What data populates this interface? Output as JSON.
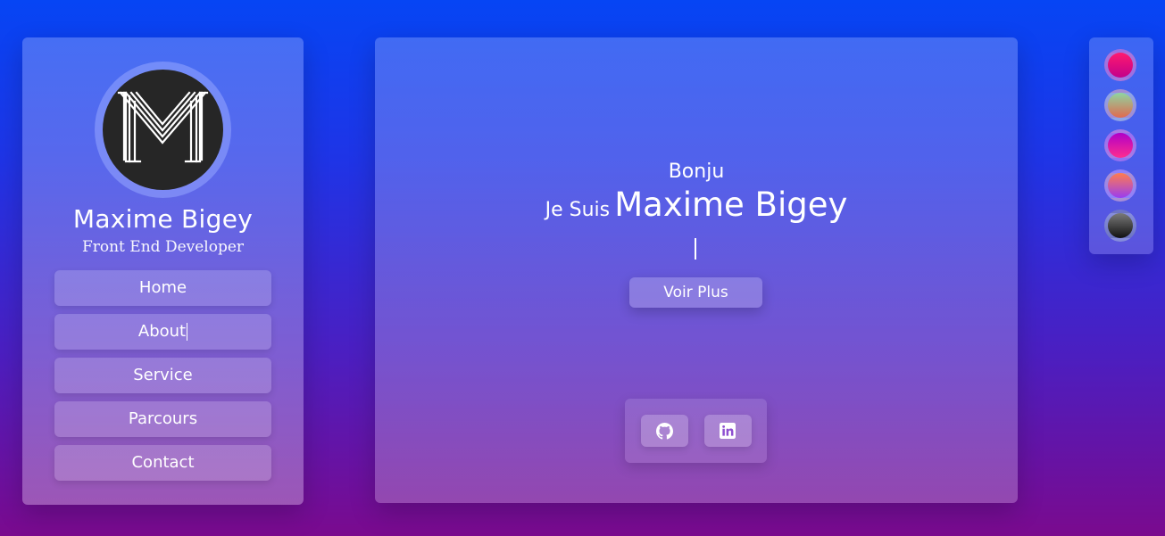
{
  "sidebar": {
    "avatar_icon": "m-monogram-logo",
    "name": "Maxime Bigey",
    "role": "Front End Developer",
    "nav": [
      {
        "label": "Home"
      },
      {
        "label": "About"
      },
      {
        "label": "Service"
      },
      {
        "label": "Parcours"
      },
      {
        "label": "Contact"
      }
    ]
  },
  "hero": {
    "greeting": "Bonju",
    "intro_prefix": "Je Suis",
    "intro_name": "Maxime Bigey",
    "cta_label": "Voir Plus"
  },
  "socials": [
    {
      "icon": "github-icon"
    },
    {
      "icon": "linkedin-icon"
    }
  ],
  "theme_swatches": [
    {
      "colors": [
        "#ff1a6f",
        "#c2008a"
      ]
    },
    {
      "colors": [
        "#8fd5a0",
        "#e06a4f"
      ]
    },
    {
      "colors": [
        "#b000c8",
        "#ff2d8f"
      ]
    },
    {
      "colors": [
        "#ff7c4f",
        "#9a3cf0"
      ]
    },
    {
      "colors": [
        "#7a7a7a",
        "#111111"
      ]
    }
  ],
  "colors": {
    "background_top": "#0645f4",
    "background_bottom": "#7a0a8e",
    "avatar_bg": "#262626"
  }
}
